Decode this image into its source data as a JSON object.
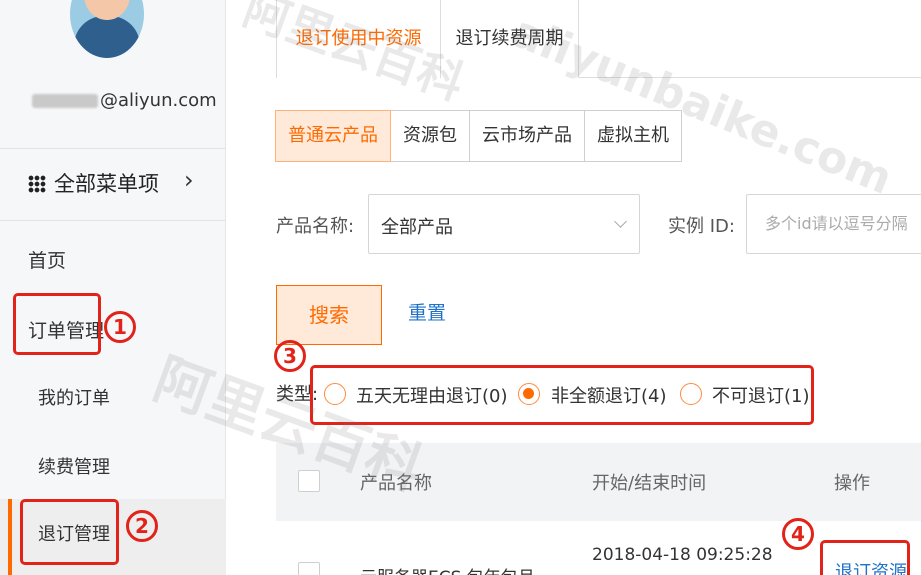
{
  "sidebar": {
    "email": "@aliyun.com",
    "all_menu_label": "全部菜单项",
    "items": {
      "home": "首页",
      "order_mgmt": "订单管理",
      "my_orders": "我的订单",
      "renew_mgmt": "续费管理",
      "refund_mgmt": "退订管理"
    }
  },
  "annotations": {
    "n1": "1",
    "n2": "2",
    "n3": "3",
    "n4": "4"
  },
  "main": {
    "tabs": [
      "退订使用中资源",
      "退订续费周期"
    ],
    "product_types": [
      "普通云产品",
      "资源包",
      "云市场产品",
      "虚拟主机"
    ],
    "filters": {
      "product_name_label": "产品名称:",
      "product_name_value": "全部产品",
      "instance_id_label": "实例 ID:",
      "instance_id_placeholder": "多个id请以逗号分隔"
    },
    "buttons": {
      "search": "搜索",
      "reset": "重置"
    },
    "type_filter": {
      "label": "类型:",
      "options": [
        {
          "label": "五天无理由退订(0)",
          "checked": false
        },
        {
          "label": "非全额退订(4)",
          "checked": true
        },
        {
          "label": "不可退订(1)",
          "checked": false
        }
      ]
    },
    "table": {
      "headers": [
        "产品名称",
        "开始/结束时间",
        "操作"
      ],
      "rows": [
        {
          "product": "云服务器ECS 包年包月",
          "start_time": "2018-04-18 09:25:28",
          "action": "退订资源"
        }
      ]
    }
  },
  "watermark": {
    "line1": "阿里云百科",
    "line2": "aliyunbaike.com"
  },
  "colors": {
    "accent": "#ff6a00",
    "link": "#1e73c9",
    "annotation": "#e2231a"
  }
}
